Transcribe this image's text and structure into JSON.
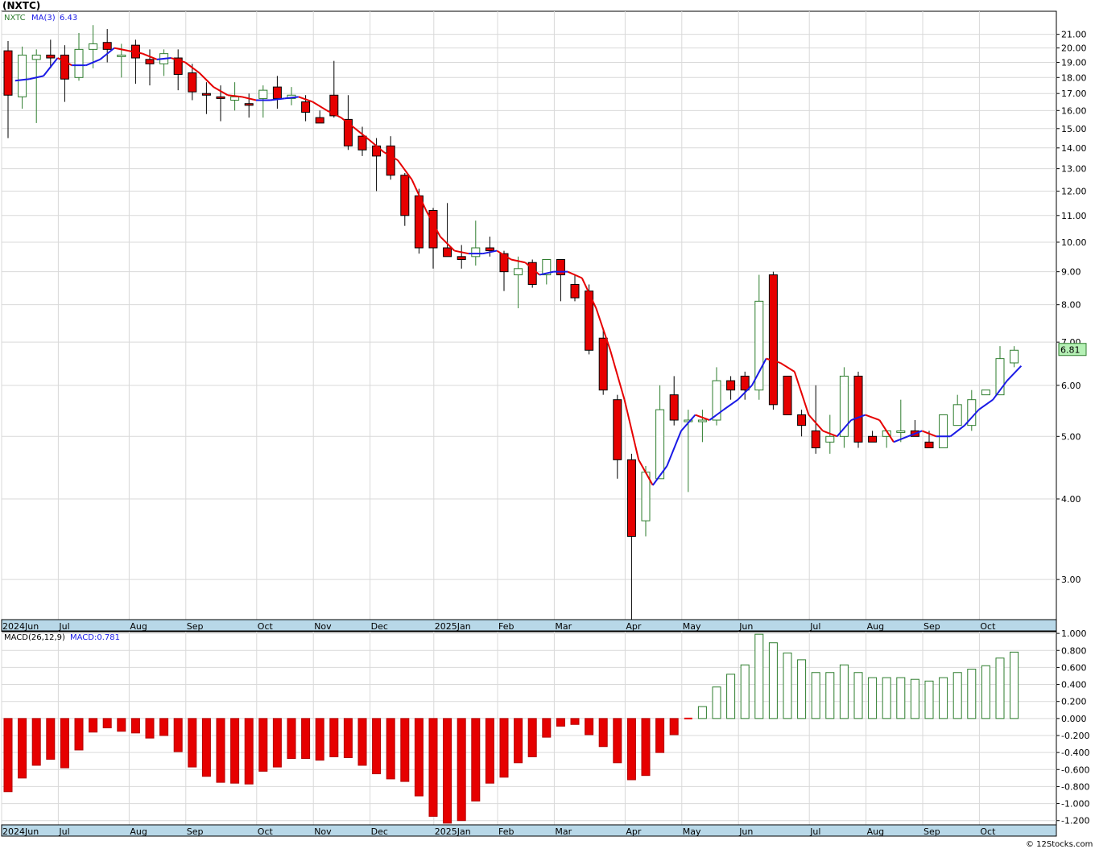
{
  "page": {
    "title": "(NXTC)",
    "footer": "© 12Stocks.com"
  },
  "colors": {
    "up_candle": "#2e7d2e",
    "down_candle": "#e60000",
    "ma_up": "#1a1ae6",
    "ma_down": "#e60000",
    "grid": "#d9d9d9",
    "axis_band": "#b8d8e8",
    "last_price_box": "#b5f0b5"
  },
  "chart_data": [
    {
      "type": "candlestick",
      "name": "price",
      "y_scale": "log",
      "ylim": [
        2.6,
        22.8
      ],
      "legend": {
        "symbol": "NXTC",
        "ma_label": "MA(3)",
        "ma_value": "6.43"
      },
      "last_price_label": "6.81",
      "y_ticks": [
        {
          "value": 21,
          "label": "21.00"
        },
        {
          "value": 20,
          "label": "20.00"
        },
        {
          "value": 19,
          "label": "19.00"
        },
        {
          "value": 18,
          "label": "18.00"
        },
        {
          "value": 17,
          "label": "17.00"
        },
        {
          "value": 16,
          "label": "16.00"
        },
        {
          "value": 15,
          "label": "15.00"
        },
        {
          "value": 14,
          "label": "14.00"
        },
        {
          "value": 13,
          "label": "13.00"
        },
        {
          "value": 12,
          "label": "12.00"
        },
        {
          "value": 11,
          "label": "11.00"
        },
        {
          "value": 10,
          "label": "10.00"
        },
        {
          "value": 9,
          "label": "9.00"
        },
        {
          "value": 8,
          "label": "8.00"
        },
        {
          "value": 7,
          "label": "7.00"
        },
        {
          "value": 6,
          "label": "6.00"
        },
        {
          "value": 5,
          "label": "5.00"
        },
        {
          "value": 4,
          "label": "4.00"
        },
        {
          "value": 3,
          "label": "3.00"
        }
      ],
      "x_labels": [
        {
          "week": 0,
          "label": "2024Jun"
        },
        {
          "week": 4,
          "label": "Jul"
        },
        {
          "week": 9,
          "label": "Aug"
        },
        {
          "week": 13,
          "label": "Sep"
        },
        {
          "week": 18,
          "label": "Oct"
        },
        {
          "week": 22,
          "label": "Nov"
        },
        {
          "week": 26,
          "label": "Dec"
        },
        {
          "week": 30.5,
          "label": "2025Jan"
        },
        {
          "week": 35,
          "label": "Feb"
        },
        {
          "week": 39,
          "label": "Mar"
        },
        {
          "week": 44,
          "label": "Apr"
        },
        {
          "week": 48,
          "label": "May"
        },
        {
          "week": 52,
          "label": "Jun"
        },
        {
          "week": 57,
          "label": "Jul"
        },
        {
          "week": 61,
          "label": "Aug"
        },
        {
          "week": 65,
          "label": "Sep"
        },
        {
          "week": 69,
          "label": "Oct"
        }
      ],
      "candles": [
        {
          "o": 19.8,
          "h": 20.5,
          "l": 14.5,
          "c": 16.9
        },
        {
          "o": 16.8,
          "h": 20.1,
          "l": 16.1,
          "c": 19.5
        },
        {
          "o": 19.2,
          "h": 19.9,
          "l": 15.3,
          "c": 19.5
        },
        {
          "o": 19.5,
          "h": 20.6,
          "l": 18.6,
          "c": 19.3
        },
        {
          "o": 19.5,
          "h": 20.2,
          "l": 16.5,
          "c": 17.9
        },
        {
          "o": 18.0,
          "h": 21.1,
          "l": 17.8,
          "c": 19.9
        },
        {
          "o": 19.9,
          "h": 21.7,
          "l": 18.6,
          "c": 20.3
        },
        {
          "o": 20.4,
          "h": 21.4,
          "l": 19.0,
          "c": 19.9
        },
        {
          "o": 19.5,
          "h": 20.3,
          "l": 18.0,
          "c": 19.5
        },
        {
          "o": 20.2,
          "h": 20.6,
          "l": 17.6,
          "c": 19.3
        },
        {
          "o": 19.2,
          "h": 19.9,
          "l": 17.5,
          "c": 18.9
        },
        {
          "o": 18.9,
          "h": 19.9,
          "l": 18.1,
          "c": 19.6
        },
        {
          "o": 19.3,
          "h": 19.9,
          "l": 17.2,
          "c": 18.2
        },
        {
          "o": 18.3,
          "h": 18.9,
          "l": 16.6,
          "c": 17.1
        },
        {
          "o": 17.0,
          "h": 17.7,
          "l": 15.8,
          "c": 16.9
        },
        {
          "o": 16.8,
          "h": 17.5,
          "l": 15.4,
          "c": 16.7
        },
        {
          "o": 16.6,
          "h": 17.7,
          "l": 16.0,
          "c": 16.8
        },
        {
          "o": 16.4,
          "h": 17.0,
          "l": 15.6,
          "c": 16.3
        },
        {
          "o": 16.7,
          "h": 17.5,
          "l": 15.6,
          "c": 17.2
        },
        {
          "o": 17.4,
          "h": 18.1,
          "l": 16.1,
          "c": 16.7
        },
        {
          "o": 16.7,
          "h": 17.4,
          "l": 16.3,
          "c": 16.9
        },
        {
          "o": 16.5,
          "h": 16.9,
          "l": 15.4,
          "c": 15.9
        },
        {
          "o": 15.6,
          "h": 16.0,
          "l": 15.3,
          "c": 15.3
        },
        {
          "o": 16.9,
          "h": 19.1,
          "l": 15.6,
          "c": 15.7
        },
        {
          "o": 15.5,
          "h": 16.9,
          "l": 13.9,
          "c": 14.1
        },
        {
          "o": 14.6,
          "h": 15.1,
          "l": 13.6,
          "c": 13.9
        },
        {
          "o": 14.1,
          "h": 14.5,
          "l": 12.0,
          "c": 13.6
        },
        {
          "o": 14.1,
          "h": 14.6,
          "l": 12.5,
          "c": 12.7
        },
        {
          "o": 12.7,
          "h": 12.8,
          "l": 10.6,
          "c": 11.0
        },
        {
          "o": 11.8,
          "h": 12.1,
          "l": 9.6,
          "c": 9.8
        },
        {
          "o": 11.2,
          "h": 11.3,
          "l": 9.1,
          "c": 9.8
        },
        {
          "o": 9.8,
          "h": 11.5,
          "l": 9.5,
          "c": 9.5
        },
        {
          "o": 9.5,
          "h": 9.9,
          "l": 9.1,
          "c": 9.4
        },
        {
          "o": 9.5,
          "h": 10.8,
          "l": 9.2,
          "c": 9.8
        },
        {
          "o": 9.8,
          "h": 10.2,
          "l": 9.5,
          "c": 9.7
        },
        {
          "o": 9.6,
          "h": 9.7,
          "l": 8.4,
          "c": 9.0
        },
        {
          "o": 8.9,
          "h": 9.5,
          "l": 7.9,
          "c": 9.1
        },
        {
          "o": 9.3,
          "h": 9.4,
          "l": 8.5,
          "c": 8.6
        },
        {
          "o": 8.9,
          "h": 9.4,
          "l": 8.6,
          "c": 9.4
        },
        {
          "o": 9.4,
          "h": 9.4,
          "l": 8.1,
          "c": 8.9
        },
        {
          "o": 8.6,
          "h": 8.9,
          "l": 8.1,
          "c": 8.2
        },
        {
          "o": 8.4,
          "h": 8.6,
          "l": 6.7,
          "c": 6.8
        },
        {
          "o": 7.1,
          "h": 7.3,
          "l": 5.8,
          "c": 5.9
        },
        {
          "o": 5.7,
          "h": 5.8,
          "l": 4.3,
          "c": 4.6
        },
        {
          "o": 4.6,
          "h": 4.7,
          "l": 2.6,
          "c": 3.5
        },
        {
          "o": 3.7,
          "h": 4.5,
          "l": 3.5,
          "c": 4.4
        },
        {
          "o": 4.3,
          "h": 6.0,
          "l": 4.3,
          "c": 5.5
        },
        {
          "o": 5.8,
          "h": 6.2,
          "l": 5.2,
          "c": 5.3
        },
        {
          "o": 5.3,
          "h": 5.5,
          "l": 4.1,
          "c": 5.3
        },
        {
          "o": 5.3,
          "h": 5.5,
          "l": 4.9,
          "c": 5.3
        },
        {
          "o": 5.3,
          "h": 6.4,
          "l": 5.2,
          "c": 6.1
        },
        {
          "o": 6.1,
          "h": 6.2,
          "l": 5.7,
          "c": 5.9
        },
        {
          "o": 6.2,
          "h": 6.3,
          "l": 5.7,
          "c": 5.9
        },
        {
          "o": 5.9,
          "h": 8.9,
          "l": 5.7,
          "c": 8.1
        },
        {
          "o": 8.9,
          "h": 9.0,
          "l": 5.5,
          "c": 5.6
        },
        {
          "o": 6.2,
          "h": 6.2,
          "l": 5.4,
          "c": 5.4
        },
        {
          "o": 5.4,
          "h": 5.5,
          "l": 5.0,
          "c": 5.2
        },
        {
          "o": 5.1,
          "h": 6.0,
          "l": 4.7,
          "c": 4.8
        },
        {
          "o": 4.9,
          "h": 5.4,
          "l": 4.7,
          "c": 5.0
        },
        {
          "o": 5.0,
          "h": 6.4,
          "l": 4.8,
          "c": 6.2
        },
        {
          "o": 6.2,
          "h": 6.3,
          "l": 4.8,
          "c": 4.9
        },
        {
          "o": 5.0,
          "h": 5.1,
          "l": 4.9,
          "c": 4.9
        },
        {
          "o": 5.0,
          "h": 5.1,
          "l": 4.8,
          "c": 5.1
        },
        {
          "o": 5.1,
          "h": 5.7,
          "l": 4.9,
          "c": 5.1
        },
        {
          "o": 5.1,
          "h": 5.3,
          "l": 5.0,
          "c": 5.0
        },
        {
          "o": 4.9,
          "h": 5.1,
          "l": 4.8,
          "c": 4.8
        },
        {
          "o": 4.8,
          "h": 5.4,
          "l": 4.8,
          "c": 5.4
        },
        {
          "o": 5.2,
          "h": 5.8,
          "l": 5.2,
          "c": 5.6
        },
        {
          "o": 5.2,
          "h": 5.9,
          "l": 5.1,
          "c": 5.7
        },
        {
          "o": 5.8,
          "h": 5.9,
          "l": 5.8,
          "c": 5.9
        },
        {
          "o": 5.8,
          "h": 6.9,
          "l": 5.8,
          "c": 6.6
        },
        {
          "o": 6.5,
          "h": 6.9,
          "l": 6.4,
          "c": 6.8
        }
      ],
      "ma3": [
        17.8,
        17.9,
        18.1,
        19.3,
        18.8,
        18.8,
        19.2,
        20.0,
        19.8,
        19.6,
        19.2,
        19.3,
        19.0,
        18.3,
        17.4,
        16.9,
        16.8,
        16.6,
        16.6,
        16.7,
        16.8,
        16.5,
        16.0,
        15.6,
        15.0,
        14.4,
        13.8,
        13.4,
        12.5,
        11.2,
        10.2,
        9.7,
        9.6,
        9.6,
        9.7,
        9.4,
        9.3,
        8.9,
        9.0,
        9.0,
        8.8,
        7.9,
        6.8,
        5.7,
        4.6,
        4.2,
        4.5,
        5.1,
        5.4,
        5.3,
        5.5,
        5.7,
        6.0,
        6.6,
        6.5,
        6.3,
        5.4,
        5.1,
        5.0,
        5.3,
        5.4,
        5.3,
        4.9,
        5.0,
        5.1,
        5.0,
        5.0,
        5.2,
        5.5,
        5.7,
        6.1,
        6.43
      ]
    },
    {
      "type": "bar",
      "name": "macd",
      "legend": {
        "label": "MACD(26,12,9)",
        "value_label": "MACD:0.781"
      },
      "ylim": [
        -1.25,
        1.02
      ],
      "y_ticks": [
        {
          "value": 1.0,
          "label": "1.000"
        },
        {
          "value": 0.8,
          "label": "0.800"
        },
        {
          "value": 0.6,
          "label": "0.600"
        },
        {
          "value": 0.4,
          "label": "0.400"
        },
        {
          "value": 0.2,
          "label": "0.200"
        },
        {
          "value": 0.0,
          "label": "0.000"
        },
        {
          "value": -0.2,
          "label": "-0.200"
        },
        {
          "value": -0.4,
          "label": "-0.400"
        },
        {
          "value": -0.6,
          "label": "-0.600"
        },
        {
          "value": -0.8,
          "label": "-0.800"
        },
        {
          "value": -1.0,
          "label": "-1.000"
        },
        {
          "value": -1.2,
          "label": "-1.200"
        }
      ],
      "values": [
        -0.86,
        -0.7,
        -0.55,
        -0.48,
        -0.58,
        -0.37,
        -0.16,
        -0.11,
        -0.15,
        -0.17,
        -0.23,
        -0.2,
        -0.39,
        -0.57,
        -0.68,
        -0.75,
        -0.76,
        -0.77,
        -0.62,
        -0.57,
        -0.47,
        -0.47,
        -0.49,
        -0.45,
        -0.46,
        -0.55,
        -0.65,
        -0.71,
        -0.74,
        -0.91,
        -1.15,
        -1.23,
        -1.2,
        -0.97,
        -0.76,
        -0.69,
        -0.52,
        -0.45,
        -0.22,
        -0.09,
        -0.07,
        -0.19,
        -0.33,
        -0.52,
        -0.72,
        -0.67,
        -0.4,
        -0.19,
        0.0,
        0.14,
        0.37,
        0.52,
        0.63,
        0.99,
        0.89,
        0.77,
        0.69,
        0.54,
        0.54,
        0.63,
        0.54,
        0.48,
        0.48,
        0.48,
        0.46,
        0.44,
        0.48,
        0.54,
        0.58,
        0.62,
        0.71,
        0.78
      ],
      "x_labels_same_as_price": true
    }
  ]
}
